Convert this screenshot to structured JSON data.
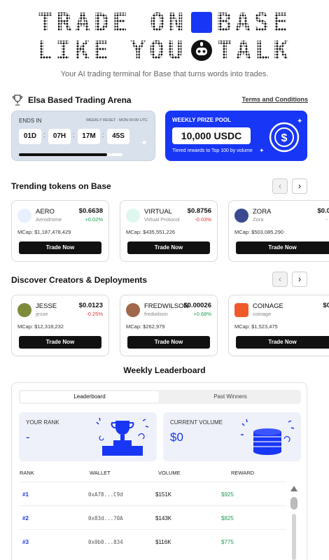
{
  "hero": {
    "line1_left": "TRADE ON",
    "line1_right": "BASE",
    "line2_left": "LIKE YOU",
    "line2_right": "TALK",
    "tagline": "Your AI trading terminal for Base that turns words into trades."
  },
  "arena": {
    "title": "Elsa Based Trading Arena",
    "terms_link": "Terms and Conditions",
    "timer": {
      "ends_label": "ENDS IN",
      "reset_note": "WEEKLY RESET · MON 00:00 UTC",
      "days": "01D",
      "hours": "07H",
      "minutes": "17M",
      "seconds": "45S",
      "progress_fraction": 0.85
    },
    "prize": {
      "label": "WEEKLY PRIZE POOL",
      "amount": "10,000 USDC",
      "subtitle": "Tiered rewards to Top 100 by volume"
    }
  },
  "trending": {
    "title": "Trending tokens on Base",
    "cards": [
      {
        "name": "AERO",
        "sub": "Aerodrome",
        "price": "$0.6638",
        "change": "+0.02%",
        "dir": "up",
        "mcap": "MCap: $1,187,478,429",
        "cta": "Trade Now",
        "icon_color": "#e8f0ff"
      },
      {
        "name": "VIRTUAL",
        "sub": "Virtual Protocol",
        "price": "$0.8756",
        "change": "-0.03%",
        "dir": "down",
        "mcap": "MCap: $435,551,226",
        "cta": "Trade Now",
        "icon_color": "#dff7ef"
      },
      {
        "name": "ZORA",
        "sub": "Zora",
        "price": "$0.0",
        "change": "-",
        "dir": "down",
        "mcap": "MCap: $503,085,290",
        "cta": "Trade Now",
        "icon_color": "#3b4a8f"
      }
    ]
  },
  "creators": {
    "title": "Discover Creators & Deployments",
    "cards": [
      {
        "name": "JESSE",
        "sub": "jesse",
        "price": "$0.0123",
        "change": "-0.25%",
        "dir": "down",
        "mcap": "MCap: $12,318,232",
        "cta": "Trade Now",
        "icon_color": "#7d8b3a"
      },
      {
        "name": "FREDWILSON",
        "sub": "fredwilson",
        "price": "$0.00026",
        "change": "+0.68%",
        "dir": "up",
        "mcap": "MCap: $262,979",
        "cta": "Trade Now",
        "icon_color": "#a0684a"
      },
      {
        "name": "COINAGE",
        "sub": "coinage",
        "price": "$0",
        "change": "",
        "dir": "up",
        "mcap": "MCap: $1,523,475",
        "cta": "Trade Now",
        "icon_color": "#f05a28"
      }
    ]
  },
  "leaderboard": {
    "title": "Weekly Leaderboard",
    "tabs": [
      "Leaderboard",
      "Past Winners"
    ],
    "your_rank_label": "YOUR RANK",
    "your_rank_value": "-",
    "volume_label": "CURRENT VOLUME",
    "volume_value": "$0",
    "columns": [
      "RANK",
      "WALLET",
      "VOLUME",
      "REWARD"
    ],
    "rows": [
      {
        "rank": "#1",
        "wallet": "0xA78...C9d",
        "volume": "$151K",
        "reward": "$925"
      },
      {
        "rank": "#2",
        "wallet": "0x83d...70A",
        "volume": "$143K",
        "reward": "$825"
      },
      {
        "rank": "#3",
        "wallet": "0x0b0...834",
        "volume": "$116K",
        "reward": "$775"
      }
    ]
  },
  "colors": {
    "brand": "#1836f5",
    "up": "#1f9d55",
    "down": "#e0343a"
  }
}
